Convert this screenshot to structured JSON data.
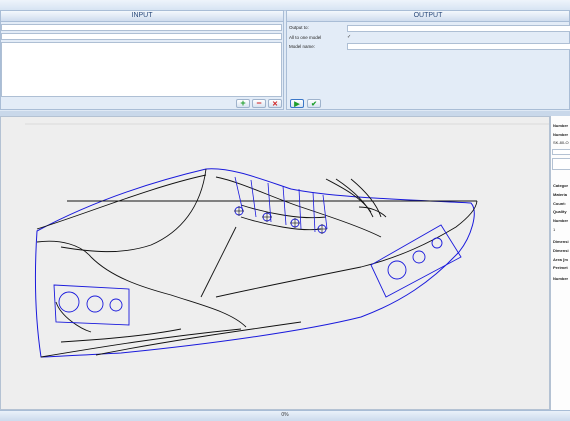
{
  "input_panel": {
    "title": "INPUT",
    "add_icon": "plus-icon",
    "remove_icon": "minus-icon",
    "delete_icon": "x-icon"
  },
  "output_panel": {
    "title": "OUTPUT",
    "output_to_label": "Output to:",
    "all_to_one_model_label": "All to one model",
    "all_to_one_model_checked": true,
    "model_name_label": "Model name:",
    "run_icon": "play-icon",
    "confirm_icon": "check-icon"
  },
  "properties_panel": {
    "number_label_1": "Number",
    "number_label_2": "Number",
    "model_code": "SK-80-O",
    "category_label": "Categor",
    "material_label": "Materia",
    "count_label": "Count:",
    "quality_label": "Quality",
    "number_label_3": "Number",
    "number_value": "1",
    "dimension_label_1": "Dimensi",
    "dimension_label_2": "Dimensi",
    "area_label": "Area [m",
    "perimeter_label": "Perimet",
    "number_label_4": "Number"
  },
  "status": {
    "progress_text": "0%",
    "progress_fraction": 0
  },
  "colors": {
    "accent": "#2a4a7a",
    "drawing_line": "#111111",
    "outline_blue": "#1a1adc",
    "add_green": "#1e9e2a",
    "remove_red": "#d01c1c"
  }
}
